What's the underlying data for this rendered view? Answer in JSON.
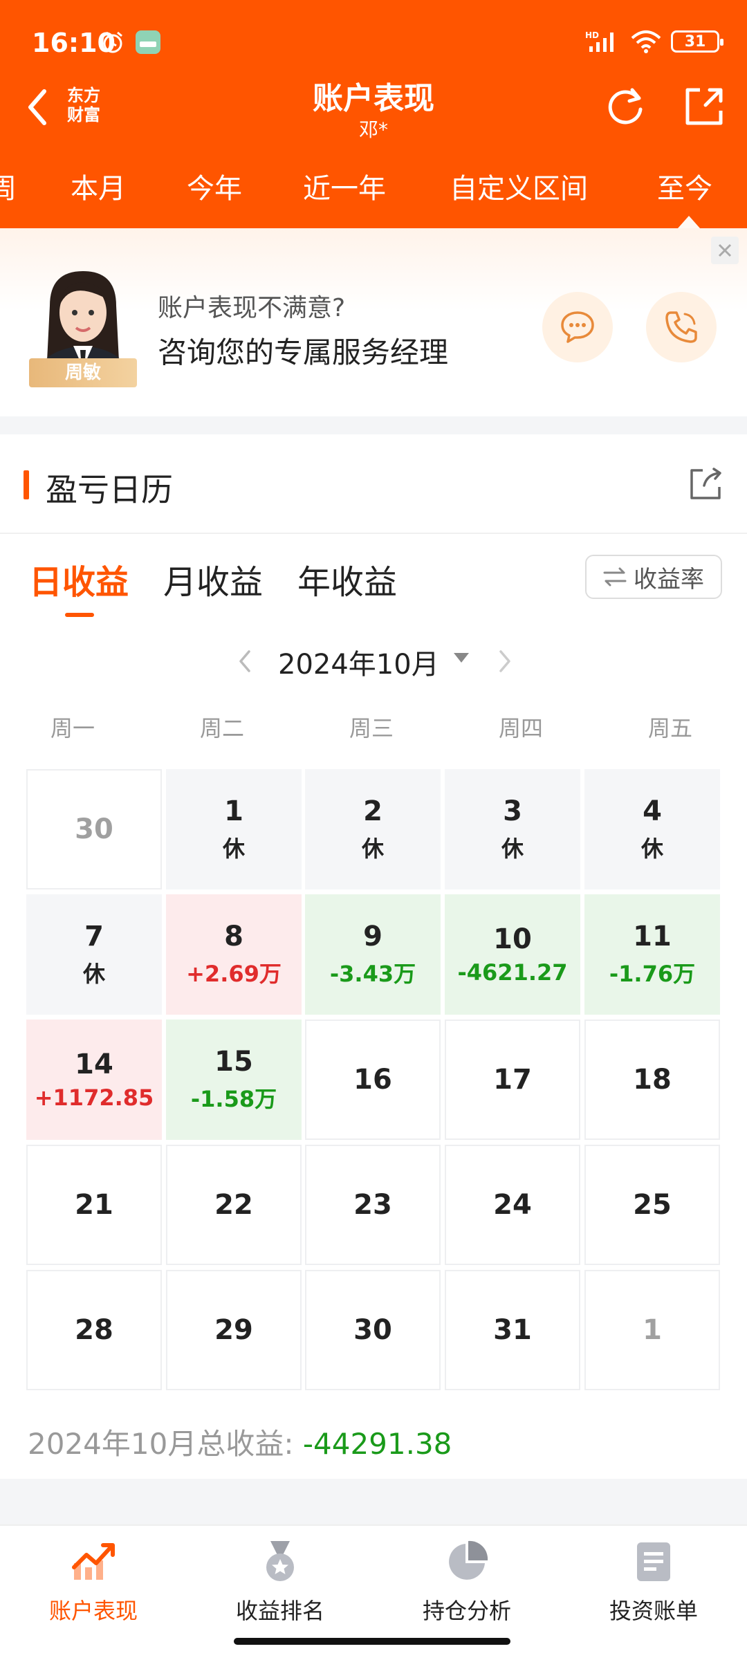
{
  "status_bar": {
    "time": "16:10",
    "network": "HD",
    "battery": "31"
  },
  "header": {
    "logo_line1": "东方",
    "logo_line2": "财富",
    "title": "账户表现",
    "subtitle": "邓*"
  },
  "period_tabs": [
    {
      "label": "周"
    },
    {
      "label": "本月"
    },
    {
      "label": "今年"
    },
    {
      "label": "近一年"
    },
    {
      "label": "自定义区间"
    },
    {
      "label": "至今"
    }
  ],
  "banner": {
    "advisor_name": "周敏",
    "question": "账户表现不满意?",
    "main": "咨询您的专属服务经理"
  },
  "calendar": {
    "title": "盈亏日历",
    "tabs": [
      {
        "label": "日收益"
      },
      {
        "label": "月收益"
      },
      {
        "label": "年收益"
      }
    ],
    "rate_button": "收益率",
    "month": "2024年10月",
    "weekdays": [
      "周一",
      "周二",
      "周三",
      "周四",
      "周五"
    ],
    "rows": [
      [
        {
          "day": "30",
          "sub": ""
        },
        {
          "day": "1",
          "sub": "休"
        },
        {
          "day": "2",
          "sub": "休"
        },
        {
          "day": "3",
          "sub": "休"
        },
        {
          "day": "4",
          "sub": "休"
        }
      ],
      [
        {
          "day": "7",
          "sub": "休"
        },
        {
          "day": "8",
          "sub": "+2.69万"
        },
        {
          "day": "9",
          "sub": "-3.43万"
        },
        {
          "day": "10",
          "sub": "-4621.27"
        },
        {
          "day": "11",
          "sub": "-1.76万"
        }
      ],
      [
        {
          "day": "14",
          "sub": "+1172.85"
        },
        {
          "day": "15",
          "sub": "-1.58万"
        },
        {
          "day": "16",
          "sub": ""
        },
        {
          "day": "17",
          "sub": ""
        },
        {
          "day": "18",
          "sub": ""
        }
      ],
      [
        {
          "day": "21",
          "sub": ""
        },
        {
          "day": "22",
          "sub": ""
        },
        {
          "day": "23",
          "sub": ""
        },
        {
          "day": "24",
          "sub": ""
        },
        {
          "day": "25",
          "sub": ""
        }
      ],
      [
        {
          "day": "28",
          "sub": ""
        },
        {
          "day": "29",
          "sub": ""
        },
        {
          "day": "30",
          "sub": ""
        },
        {
          "day": "31",
          "sub": ""
        },
        {
          "day": "1",
          "sub": ""
        }
      ]
    ],
    "total_label": "2024年10月总收益: ",
    "total_value": "-44291.38"
  },
  "bottom_nav": [
    {
      "label": "账户表现",
      "icon": "trend-chart-icon"
    },
    {
      "label": "收益排名",
      "icon": "medal-icon"
    },
    {
      "label": "持仓分析",
      "icon": "pie-chart-icon"
    },
    {
      "label": "投资账单",
      "icon": "bill-icon"
    }
  ],
  "colors": {
    "brand": "#ff5500",
    "gain": "#e02c2c",
    "loss": "#1a9a1a"
  }
}
